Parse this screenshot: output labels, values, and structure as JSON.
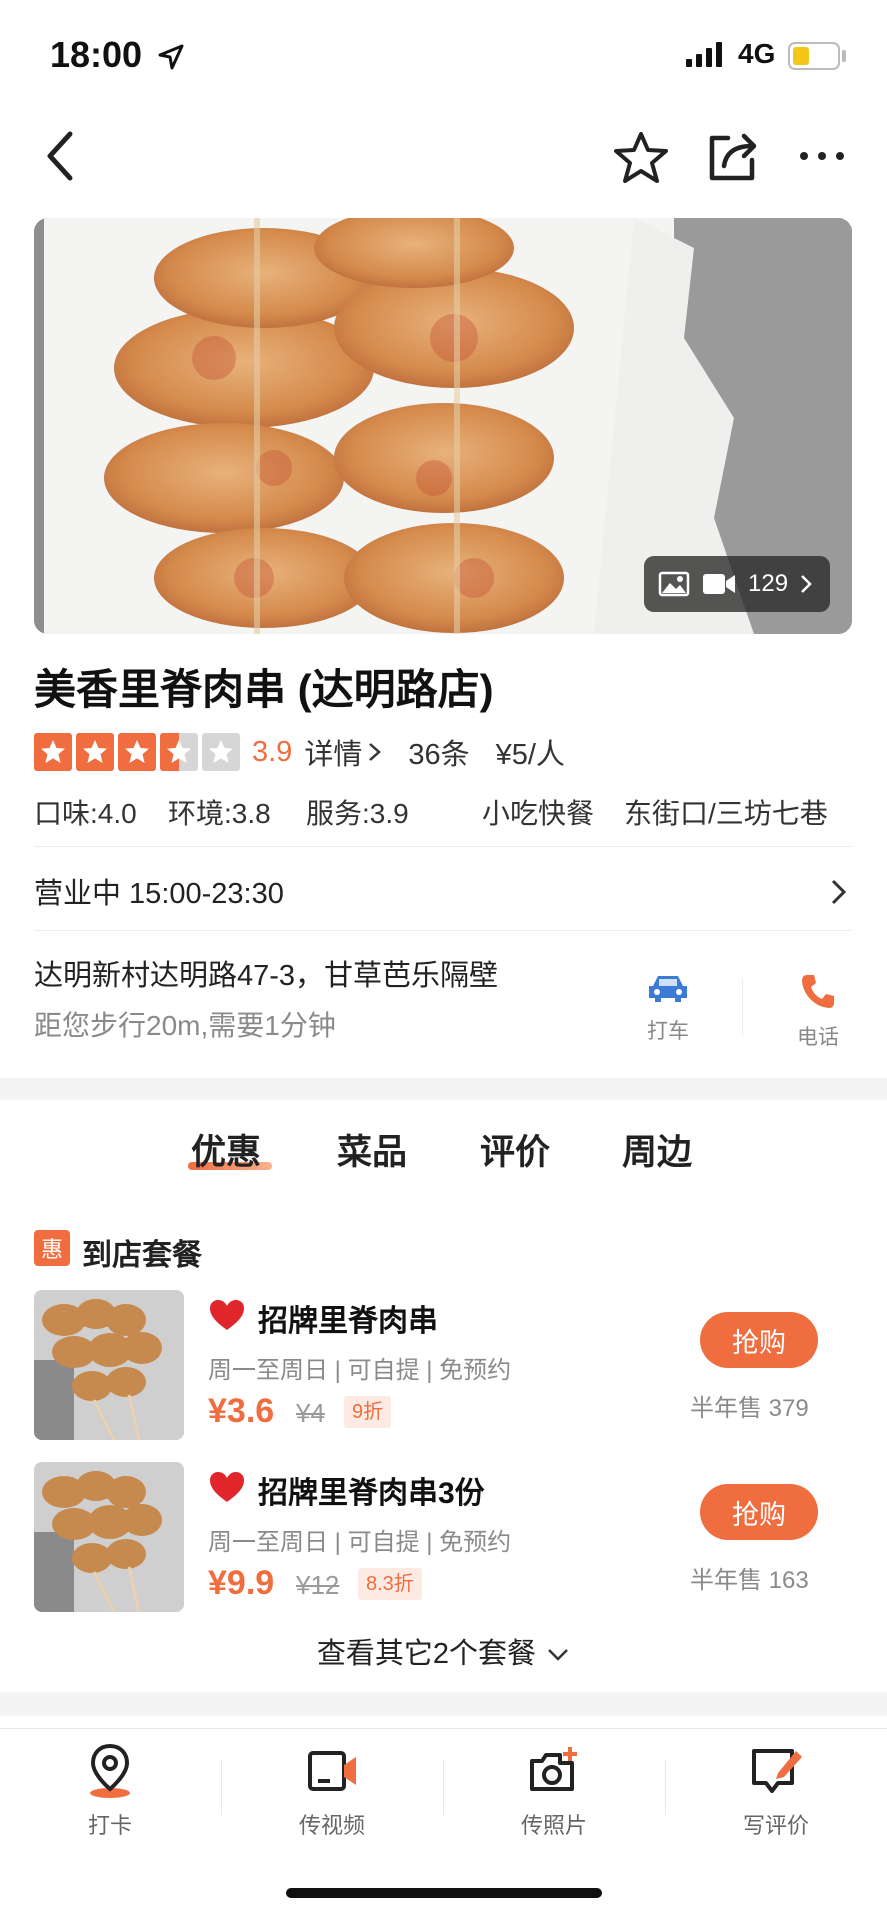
{
  "status_bar": {
    "time": "18:00",
    "network": "4G"
  },
  "nav": {
    "back": "back-icon",
    "favorite": "star-icon",
    "share": "share-icon",
    "more": "more-icon"
  },
  "hero": {
    "media_count": "129"
  },
  "shop": {
    "title": "美香里脊肉串 (达明路店)",
    "rating_score": "3.9",
    "star_rating": 3.5,
    "detail_label": "详情",
    "review_count": "36条",
    "avg_price": "¥5/人",
    "scores": {
      "taste": "口味:4.0",
      "environment": "环境:3.8",
      "service": "服务:3.9"
    },
    "category": "小吃快餐",
    "area": "东街口/三坊七巷",
    "hours": "营业中 15:00-23:30",
    "address": "达明新村达明路47-3，甘草芭乐隔壁",
    "walk_info": "距您步行20m,需要1分钟",
    "taxi_label": "打车",
    "phone_label": "电话"
  },
  "tabs": [
    "优惠",
    "菜品",
    "评价",
    "周边"
  ],
  "packages": {
    "badge": "惠",
    "title": "到店套餐",
    "deals": [
      {
        "name": "招牌里脊肉串",
        "desc": "周一至周日 | 可自提 | 免预约",
        "price": "¥3.6",
        "original": "¥4",
        "discount": "9折",
        "buy_label": "抢购",
        "sold": "半年售 379"
      },
      {
        "name": "招牌里脊肉串3份",
        "desc": "周一至周日 | 可自提 | 免预约",
        "price": "¥9.9",
        "original": "¥12",
        "discount": "8.3折",
        "buy_label": "抢购",
        "sold": "半年售 163"
      }
    ],
    "more_label": "查看其它2个套餐"
  },
  "bottom_bar": [
    {
      "label": "打卡",
      "icon": "location-pin-icon"
    },
    {
      "label": "传视频",
      "icon": "upload-video-icon"
    },
    {
      "label": "传照片",
      "icon": "upload-photo-icon"
    },
    {
      "label": "写评价",
      "icon": "write-review-icon"
    }
  ],
  "colors": {
    "accent": "#ef6d3e",
    "taxi": "#3b7bd6"
  }
}
